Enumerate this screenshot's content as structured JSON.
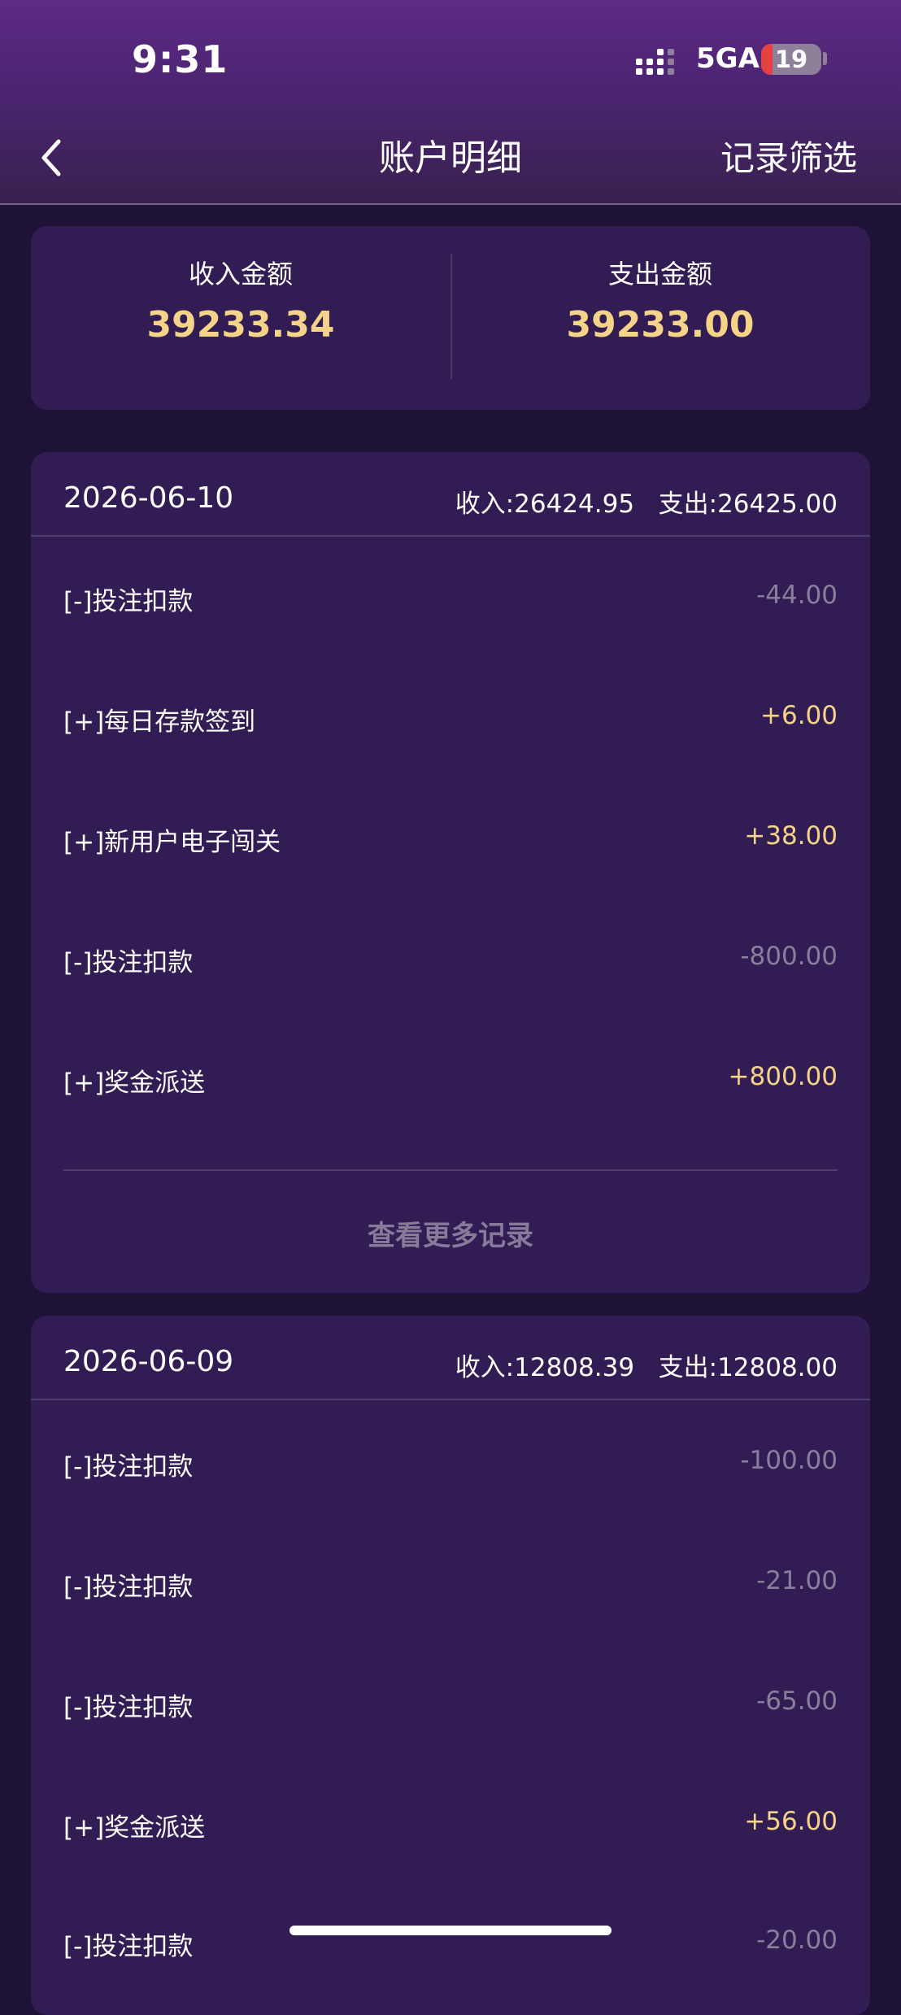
{
  "status_bar": {
    "time": "9:31",
    "network": "5GA",
    "battery": "19",
    "battery_level": 0.19,
    "signal_icon": "signal-bars-icon"
  },
  "nav": {
    "back_icon": "chevron-left-icon",
    "title": "账户明细",
    "filter_label": "记录筛选"
  },
  "summary": {
    "income_label": "收入金额",
    "income_value": "39233.34",
    "expense_label": "支出金额",
    "expense_value": "39233.00"
  },
  "days": [
    {
      "date": "2026-06-10",
      "income": "收入:26424.95",
      "expense": "支出:26425.00",
      "records": [
        {
          "label": "[-]投注扣款",
          "amount": "-44.00",
          "type": "neg"
        },
        {
          "label": "[+]每日存款签到",
          "amount": "+6.00",
          "type": "pos"
        },
        {
          "label": "[+]新用户电子闯关",
          "amount": "+38.00",
          "type": "pos"
        },
        {
          "label": "[-]投注扣款",
          "amount": "-800.00",
          "type": "neg"
        },
        {
          "label": "[+]奖金派送",
          "amount": "+800.00",
          "type": "pos"
        }
      ],
      "more_label": "查看更多记录"
    },
    {
      "date": "2026-06-09",
      "income": "收入:12808.39",
      "expense": "支出:12808.00",
      "records": [
        {
          "label": "[-]投注扣款",
          "amount": "-100.00",
          "type": "neg"
        },
        {
          "label": "[-]投注扣款",
          "amount": "-21.00",
          "type": "neg"
        },
        {
          "label": "[-]投注扣款",
          "amount": "-65.00",
          "type": "neg"
        },
        {
          "label": "[+]奖金派送",
          "amount": "+56.00",
          "type": "pos"
        },
        {
          "label": "[-]投注扣款",
          "amount": "-20.00",
          "type": "neg"
        }
      ]
    }
  ],
  "colors": {
    "background": "#1e1236",
    "card": "#311c53",
    "positive_amount": "#f5d48a",
    "negative_amount": "#8a7e9d"
  }
}
